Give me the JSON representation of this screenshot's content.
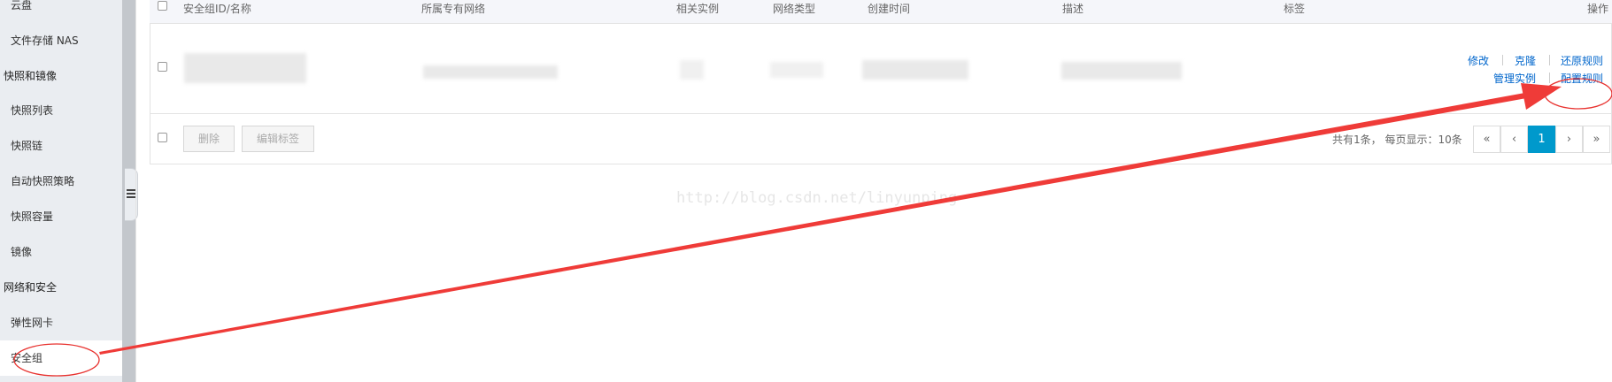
{
  "sidebar": {
    "items": [
      {
        "label": "云盘",
        "type": "sub"
      },
      {
        "label": "文件存储 NAS",
        "type": "sub"
      },
      {
        "label": "快照和镜像",
        "type": "group"
      },
      {
        "label": "快照列表",
        "type": "sub"
      },
      {
        "label": "快照链",
        "type": "sub"
      },
      {
        "label": "自动快照策略",
        "type": "sub"
      },
      {
        "label": "快照容量",
        "type": "sub"
      },
      {
        "label": "镜像",
        "type": "sub"
      },
      {
        "label": "网络和安全",
        "type": "group"
      },
      {
        "label": "弹性网卡",
        "type": "sub"
      },
      {
        "label": "安全组",
        "type": "sub",
        "active": true
      }
    ]
  },
  "table": {
    "columns": [
      "安全组ID/名称",
      "所属专有网络",
      "相关实例",
      "网络类型",
      "创建时间",
      "描述",
      "标签",
      "操作"
    ],
    "row": {
      "id_name": "",
      "vpc": "",
      "instances": "",
      "network_type": "",
      "created": "",
      "description": "",
      "tags": "",
      "actions": [
        "修改",
        "克隆",
        "还原规则",
        "管理实例",
        "配置规则"
      ]
    }
  },
  "footer": {
    "delete_label": "删除",
    "edit_tags_label": "编辑标签",
    "summary": "共有1条， 每页显示：10条",
    "pager": {
      "first": "«",
      "prev": "‹",
      "current": "1",
      "next": "›",
      "last": "»"
    }
  },
  "watermark": "http://blog.csdn.net/linyunping",
  "annotation_color": "#e8322f",
  "accent_color": "#0099cc",
  "link_color": "#0066cc"
}
